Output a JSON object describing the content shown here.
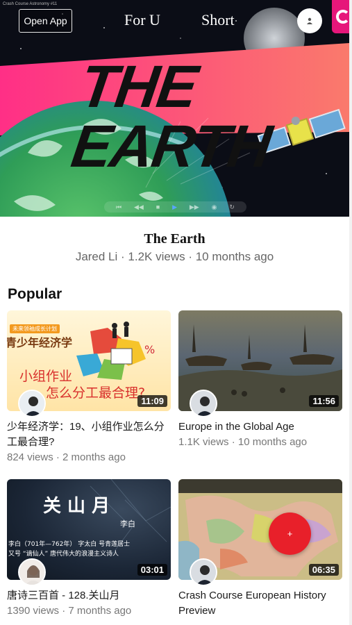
{
  "header": {
    "open_app_label": "Open App",
    "tabs": [
      "For U",
      "Short"
    ],
    "hero_title": "THE EARTH",
    "hero_caption": "Crash Course Astronomy #11"
  },
  "video": {
    "title": "The Earth",
    "meta": "Jared Li · 1.2K views · 10 months ago"
  },
  "section": {
    "title": "Popular"
  },
  "cards": [
    {
      "title": "少年经济学：19、小组作业怎么分工最合理?",
      "meta": "824 views · 2 months ago",
      "duration": "11:09",
      "thumb_tag": "未来领袖成长计划",
      "thumb_heading": "青少年经济学",
      "thumb_line1": "小组作业",
      "thumb_line2": "怎么分工最合理?"
    },
    {
      "title": "Europe in the Global Age",
      "meta": "1.1K views · 10 months ago",
      "duration": "11:56"
    },
    {
      "title": "唐诗三百首 - 128.关山月",
      "meta": "1390 views · 7 months ago",
      "duration": "03:01",
      "thumb_heading": "关 山 月",
      "thumb_author": "李白",
      "thumb_line1": "李白（701年—762年）  字太白  号青莲居士",
      "thumb_line2": "又号 “谪仙人”   唐代伟大的浪漫主义诗人"
    },
    {
      "title": "Crash Course European History Preview",
      "meta": "",
      "duration": "06:35"
    }
  ],
  "fab": {
    "icon": "plus-icon",
    "label": "+"
  },
  "colors": {
    "accent": "#e8202a",
    "brand": "#e6177a",
    "hero_band": "#f25f8a"
  }
}
